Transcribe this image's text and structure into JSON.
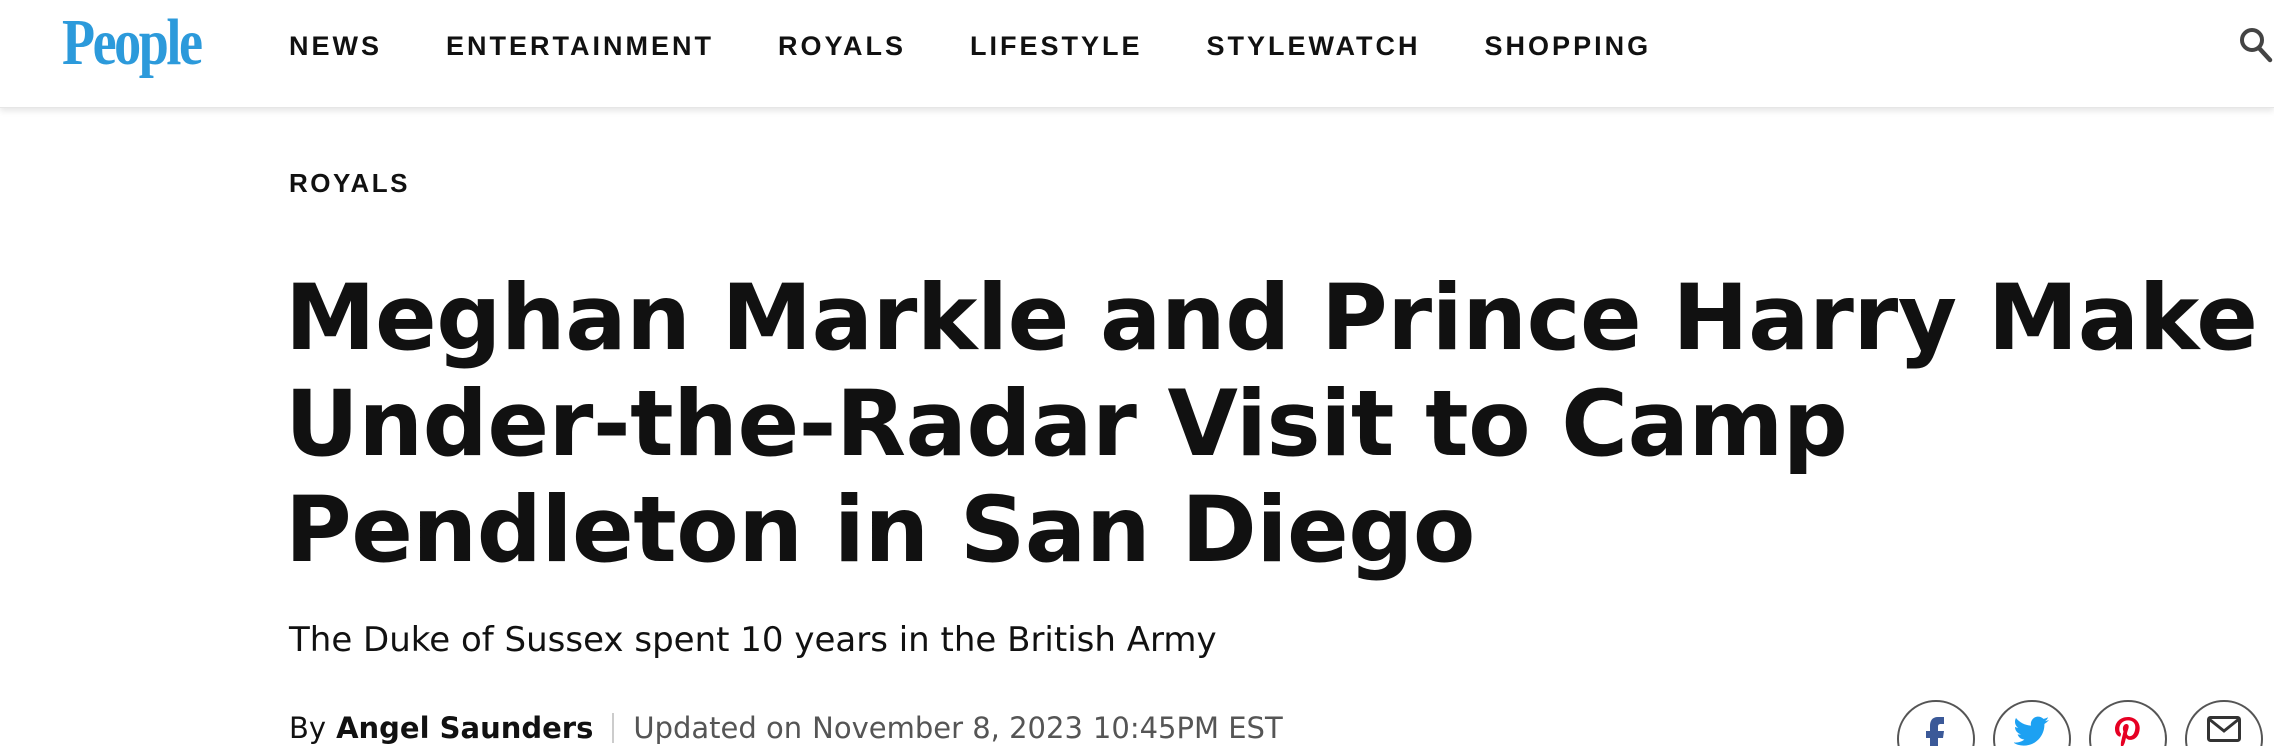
{
  "brand": {
    "logo_text": "People",
    "color": "#2c9adb"
  },
  "nav": {
    "items": [
      {
        "label": "NEWS"
      },
      {
        "label": "ENTERTAINMENT"
      },
      {
        "label": "ROYALS"
      },
      {
        "label": "LIFESTYLE"
      },
      {
        "label": "STYLEWATCH"
      },
      {
        "label": "SHOPPING"
      }
    ],
    "search_icon": "search-icon"
  },
  "article": {
    "section": "ROYALS",
    "headline": "Meghan Markle and Prince Harry Make Under-the-Radar Visit to Camp Pendleton in San Diego",
    "dek": "The Duke of Sussex spent 10 years in the British Army",
    "byline": {
      "prefix": "By",
      "author": "Angel Saunders",
      "updated_label": "Updated on",
      "date": "November 8, 2023",
      "time": "10:45PM EST"
    }
  },
  "share": {
    "icons": [
      {
        "icon": "facebook-icon",
        "color": "#3b5998"
      },
      {
        "icon": "twitter-icon",
        "color": "#1da1f2"
      },
      {
        "icon": "pinterest-icon",
        "color": "#e60023"
      },
      {
        "icon": "email-icon",
        "color": "#333333"
      }
    ]
  }
}
